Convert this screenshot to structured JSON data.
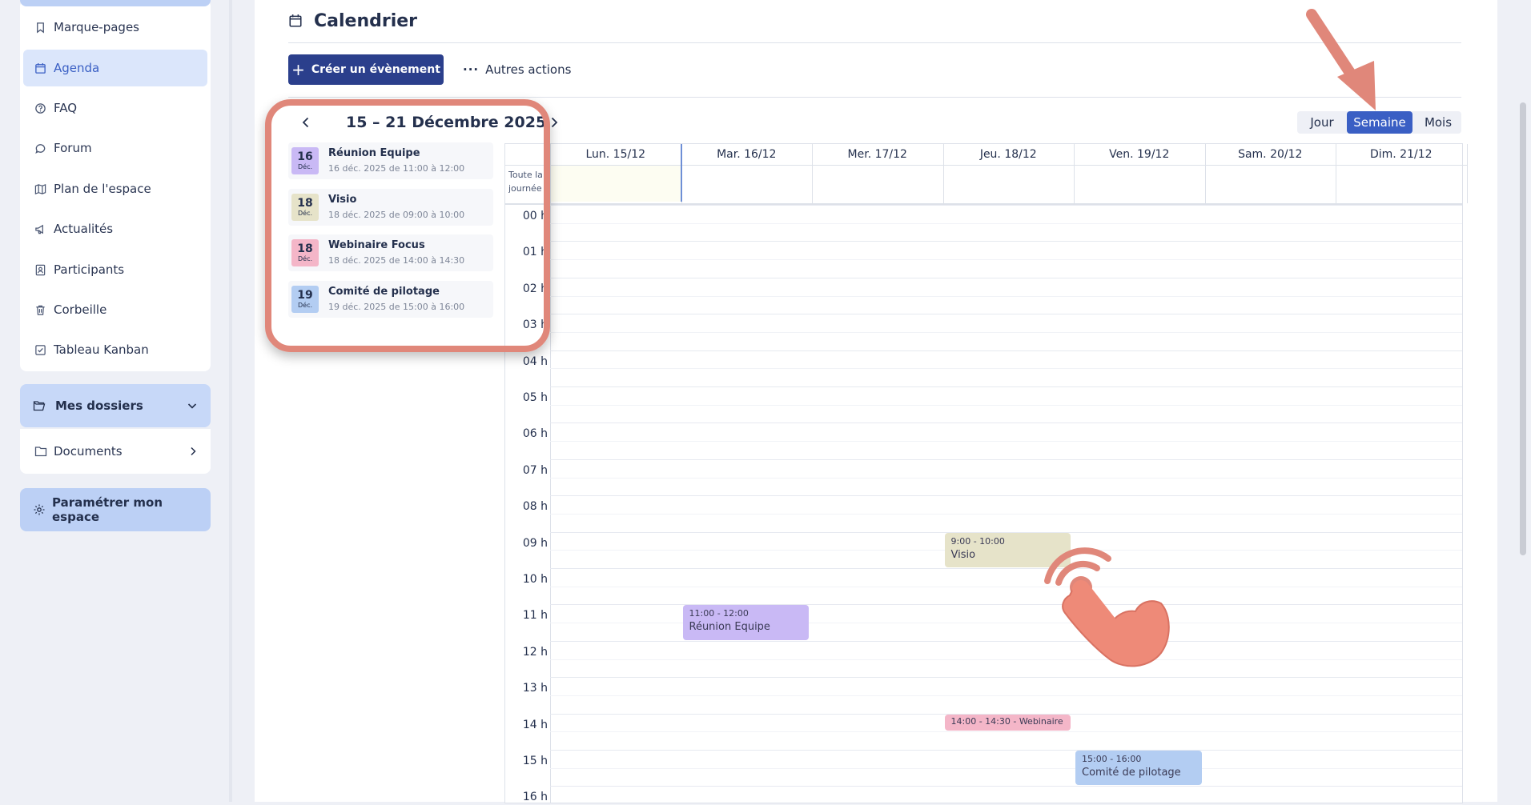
{
  "sidebar": {
    "items": [
      {
        "label": "Marque-pages",
        "icon": "bookmark-icon"
      },
      {
        "label": "Agenda",
        "icon": "calendar-icon",
        "active": true
      },
      {
        "label": "FAQ",
        "icon": "help-circle-icon"
      },
      {
        "label": "Forum",
        "icon": "chat-icon"
      },
      {
        "label": "Plan de l'espace",
        "icon": "map-icon"
      },
      {
        "label": "Actualités",
        "icon": "megaphone-icon"
      },
      {
        "label": "Participants",
        "icon": "contacts-icon"
      },
      {
        "label": "Corbeille",
        "icon": "trash-icon"
      },
      {
        "label": "Tableau Kanban",
        "icon": "checkbox-icon"
      }
    ],
    "folders_label": "Mes dossiers",
    "documents_label": "Documents",
    "settings_label": "Paramétrer mon espace"
  },
  "header": {
    "title": "Calendrier",
    "create_label": "Créer un évènement",
    "more_label": "Autres actions"
  },
  "views": [
    "Jour",
    "Semaine",
    "Mois"
  ],
  "selected_view": "Semaine",
  "agenda": {
    "range": "15 – 21 Décembre 2025",
    "events": [
      {
        "day": "16",
        "month": "Déc.",
        "title": "Réunion Equipe",
        "when": "16 déc. 2025 de 11:00 à 12:00",
        "color": "#c9b9f5"
      },
      {
        "day": "18",
        "month": "Déc.",
        "title": "Visio",
        "when": "18 déc. 2025 de 09:00 à 10:00",
        "color": "#e6e3c9"
      },
      {
        "day": "18",
        "month": "Déc.",
        "title": "Webinaire Focus",
        "when": "18 déc. 2025 de 14:00 à 14:30",
        "color": "#f4b6c8"
      },
      {
        "day": "19",
        "month": "Déc.",
        "title": "Comité de pilotage",
        "when": "19 déc. 2025 de 15:00 à 16:00",
        "color": "#b3cdf2"
      }
    ]
  },
  "calendar": {
    "days": [
      "Lun. 15/12",
      "Mar. 16/12",
      "Mer. 17/12",
      "Jeu. 18/12",
      "Ven. 19/12",
      "Sam. 20/12",
      "Dim. 21/12"
    ],
    "allday_label": "Toute la journée",
    "hours": [
      "00 h",
      "01 h",
      "02 h",
      "03 h",
      "04 h",
      "05 h",
      "06 h",
      "07 h",
      "08 h",
      "09 h",
      "10 h",
      "11 h",
      "12 h",
      "13 h",
      "14 h",
      "15 h",
      "16 h"
    ],
    "events": [
      {
        "day": 3,
        "start": 9,
        "end": 10,
        "time": "9:00 - 10:00",
        "name": "Visio",
        "color": "#e6e3c9"
      },
      {
        "day": 1,
        "start": 11,
        "end": 12,
        "time": "11:00 - 12:00",
        "name": "Réunion Equipe",
        "color": "#c9b9f5"
      },
      {
        "day": 3,
        "start": 14,
        "end": 14.5,
        "time": "14:00 - 14:30 - Webinaire",
        "name": "",
        "color": "#f4b6c8"
      },
      {
        "day": 4,
        "start": 15,
        "end": 16,
        "time": "15:00 - 16:00",
        "name": "Comité de pilotage",
        "color": "#b3cdf2"
      }
    ]
  },
  "colors": {
    "accent": "#3a5fc4",
    "primary_button": "#2b3f8c",
    "annotation": "#e0877a"
  }
}
